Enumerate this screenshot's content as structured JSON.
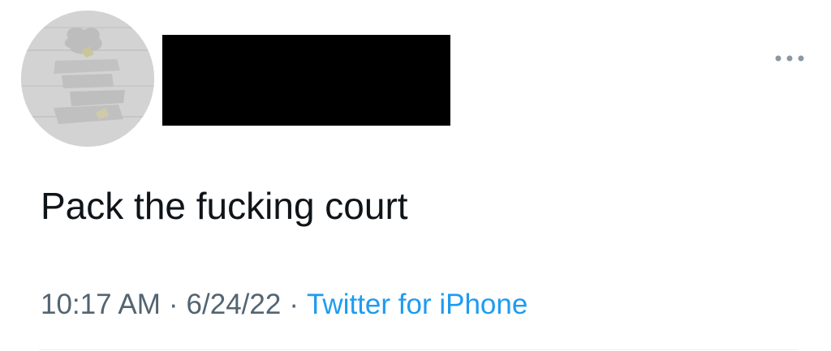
{
  "tweet": {
    "text": "Pack the fucking court",
    "time": "10:17 AM",
    "separator": "·",
    "date": "6/24/22",
    "source": "Twitter for iPhone"
  },
  "icons": {
    "more": "more-horizontal-icon",
    "avatar": "profile-avatar"
  },
  "colors": {
    "text": "#0f1419",
    "secondary": "#536471",
    "accent": "#1d9bf0",
    "redaction": "#000000"
  }
}
